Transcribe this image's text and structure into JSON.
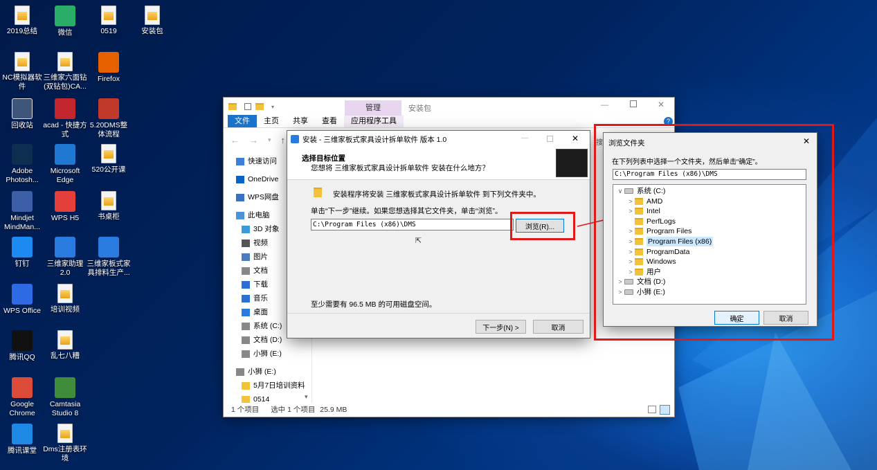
{
  "desktop": {
    "icons": [
      {
        "label": "2019总结",
        "icon": "folder-doc-icon"
      },
      {
        "label": "微信",
        "icon": "wechat-icon",
        "color": "#2aae67"
      },
      {
        "label": "0519",
        "icon": "folder-doc-icon"
      },
      {
        "label": "安装包",
        "icon": "folder-doc-icon"
      },
      {
        "label": "NC模拟器软件",
        "icon": "folder-doc-icon"
      },
      {
        "label": "三维家六面钻(双钻包)CA...",
        "icon": "folder-doc-icon"
      },
      {
        "label": "Firefox",
        "icon": "firefox-icon",
        "color": "#e66000"
      },
      {
        "label": "回收站",
        "icon": "recycle-bin-icon"
      },
      {
        "label": "acad - 快捷方式",
        "icon": "autocad-icon",
        "color": "#c4262e"
      },
      {
        "label": "5.20DMS整体流程",
        "icon": "video-icon",
        "color": "#c0392b"
      },
      {
        "label": "Adobe Photosh...",
        "icon": "photoshop-icon",
        "color": "#0d2e4e"
      },
      {
        "label": "Microsoft Edge",
        "icon": "edge-icon",
        "color": "#1f78d1"
      },
      {
        "label": "520公开课",
        "icon": "folder-doc-icon"
      },
      {
        "label": "Mindjet MindMan...",
        "icon": "mindjet-icon",
        "color": "#3d5fa8"
      },
      {
        "label": "WPS H5",
        "icon": "wps-h5-icon",
        "color": "#e43f3a"
      },
      {
        "label": "书桌柜",
        "icon": "folder-doc-icon"
      },
      {
        "label": "钉钉",
        "icon": "dingtalk-icon",
        "color": "#1d8af2"
      },
      {
        "label": "三维家助理 2.0",
        "icon": "3vjia-assistant-icon",
        "color": "#2a7be0"
      },
      {
        "label": "三维家板式家具排料生产...",
        "icon": "3vjia-furniture-icon",
        "color": "#2a7be0"
      },
      {
        "label": "WPS Office",
        "icon": "wps-office-icon",
        "color": "#2d6ae3"
      },
      {
        "label": "培训视频",
        "icon": "folder-doc-icon"
      },
      {
        "label": "腾讯QQ",
        "icon": "qq-icon",
        "color": "#111111"
      },
      {
        "label": "乱七八糟",
        "icon": "folder-doc-icon"
      },
      {
        "label": "Google Chrome",
        "icon": "chrome-icon",
        "color": "#dd4b39"
      },
      {
        "label": "Camtasia Studio 8",
        "icon": "camtasia-icon",
        "color": "#3f8d3a"
      },
      {
        "label": "腾讯课堂",
        "icon": "tencent-class-icon",
        "color": "#1e88e5"
      },
      {
        "label": "Dms注册表环境",
        "icon": "folder-doc-icon"
      }
    ]
  },
  "explorer": {
    "title": "安装包",
    "context_tab": "管理",
    "tabs": [
      "文件",
      "主页",
      "共享",
      "查看",
      "应用程序工具"
    ],
    "nav": [
      "快速访问",
      "OneDrive",
      "WPS网盘",
      "此电脑",
      "3D 对象",
      "视频",
      "图片",
      "文档",
      "下载",
      "音乐",
      "桌面",
      "系统 (C:)",
      "文档 (D:)",
      "小狮 (E:)",
      "小狮 (E:)",
      "5月7日培训资料",
      "0514"
    ],
    "status": {
      "items": "1 个项目",
      "selected": "选中 1 个项目",
      "size": "25.9 MB"
    },
    "search_stub": "搜"
  },
  "installer": {
    "title": "安装 - 三维家板式家具设计拆单软件 版本 1.0",
    "heading": "选择目标位置",
    "subheading": "您想将 三维家板式家具设计拆单软件 安装在什么地方？",
    "line1": "安装程序将安装 三维家板式家具设计拆单软件 到下列文件夹中。",
    "line2": "单击“下一步”继续。如果您想选择其它文件夹，单击“浏览”。",
    "path": "C:\\Program Files (x86)\\DMS",
    "browse_button": "浏览(R)...",
    "space": "至少需要有 96.5 MB 的可用磁盘空间。",
    "next_button": "下一步(N) >",
    "cancel_button": "取消"
  },
  "browse_dialog": {
    "title": "浏览文件夹",
    "instruction": "在下列列表中选择一个文件夹，然后单击“确定”。",
    "path": "C:\\Program Files (x86)\\DMS",
    "tree": [
      {
        "label": "系统 (C:)",
        "level": 0,
        "expanded": true,
        "kind": "drive"
      },
      {
        "label": "AMD",
        "level": 1,
        "kind": "folder",
        "expandable": true
      },
      {
        "label": "Intel",
        "level": 1,
        "kind": "folder",
        "expandable": true
      },
      {
        "label": "PerfLogs",
        "level": 1,
        "kind": "folder",
        "expandable": false
      },
      {
        "label": "Program Files",
        "level": 1,
        "kind": "folder",
        "expandable": true
      },
      {
        "label": "Program Files (x86)",
        "level": 1,
        "kind": "folder",
        "expandable": true,
        "selected": true
      },
      {
        "label": "ProgramData",
        "level": 1,
        "kind": "folder",
        "expandable": true
      },
      {
        "label": "Windows",
        "level": 1,
        "kind": "folder",
        "expandable": true
      },
      {
        "label": "用户",
        "level": 1,
        "kind": "folder",
        "expandable": true
      },
      {
        "label": "文档 (D:)",
        "level": 0,
        "kind": "drive",
        "expandable": true
      },
      {
        "label": "小狮 (E:)",
        "level": 0,
        "kind": "drive",
        "expandable": true
      }
    ],
    "ok_button": "确定",
    "cancel_button": "取消"
  },
  "colors": {
    "highlight": "#e01818",
    "selection": "#cce8ff",
    "accent": "#1a72c9"
  }
}
